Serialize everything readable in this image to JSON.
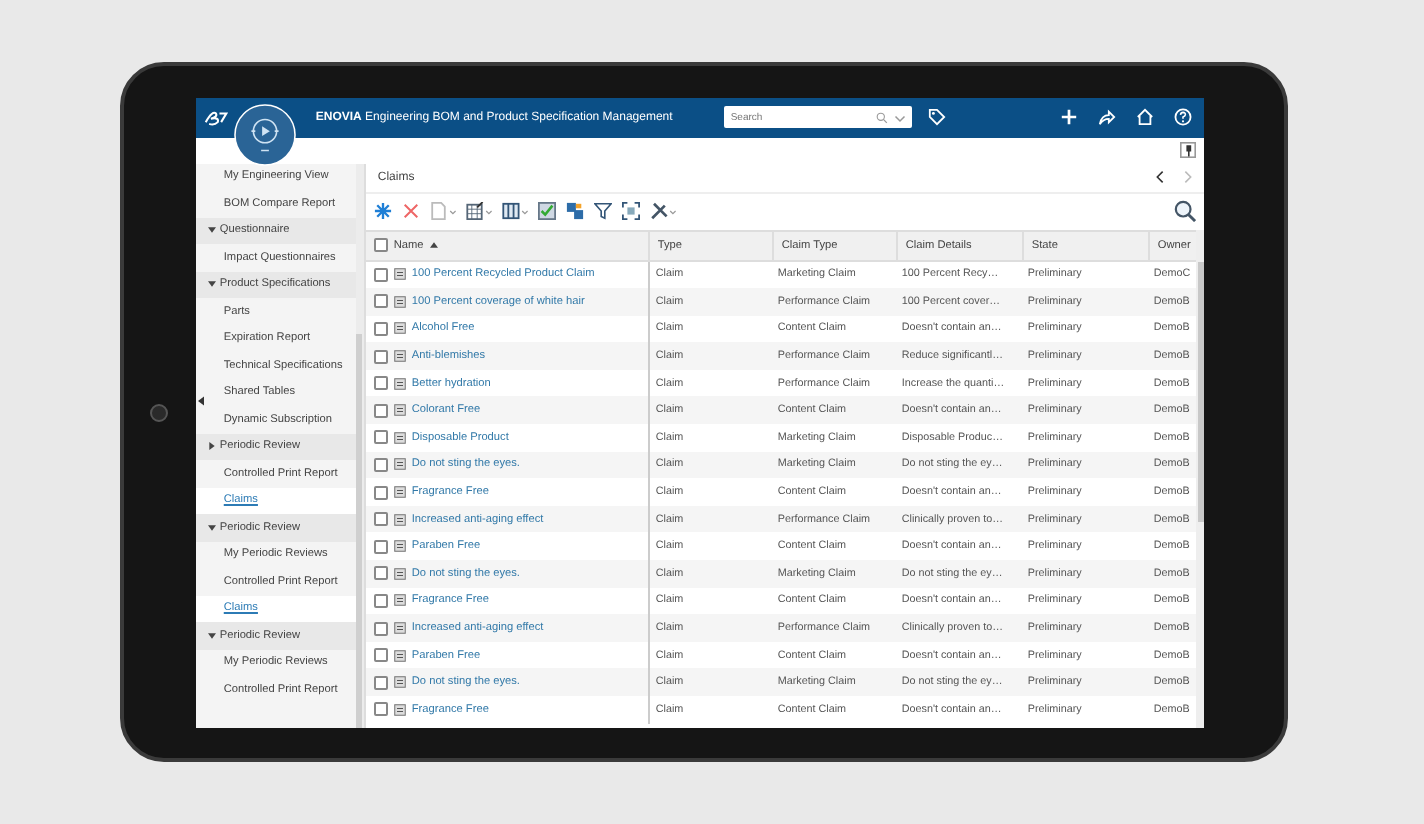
{
  "header": {
    "brand": "ENOVIA",
    "title": "Engineering BOM and Product Specification Management",
    "search": {
      "placeholder": "Search"
    }
  },
  "sidebar": {
    "items": [
      {
        "label": "My Engineering View",
        "kind": "item"
      },
      {
        "label": "BOM Compare Report",
        "kind": "item"
      },
      {
        "label": "Questionnaire",
        "kind": "section",
        "expanded": true
      },
      {
        "label": "Impact Questionnaires",
        "kind": "item"
      },
      {
        "label": "Product Specifications",
        "kind": "section",
        "expanded": true
      },
      {
        "label": "Parts",
        "kind": "item"
      },
      {
        "label": "Expiration Report",
        "kind": "item"
      },
      {
        "label": "Technical Specifications",
        "kind": "item"
      },
      {
        "label": "Shared Tables",
        "kind": "item"
      },
      {
        "label": "Dynamic Subscription",
        "kind": "item"
      },
      {
        "label": "Periodic Review",
        "kind": "section",
        "expanded": false
      },
      {
        "label": "Controlled Print Report",
        "kind": "item"
      },
      {
        "label": "Claims",
        "kind": "link"
      },
      {
        "label": "Periodic Review",
        "kind": "section",
        "expanded": true
      },
      {
        "label": "My Periodic Reviews",
        "kind": "item"
      },
      {
        "label": "Controlled Print Report",
        "kind": "item"
      },
      {
        "label": "Claims",
        "kind": "link"
      },
      {
        "label": "Periodic Review",
        "kind": "section",
        "expanded": true
      },
      {
        "label": "My Periodic Reviews",
        "kind": "item"
      },
      {
        "label": "Controlled Print Report",
        "kind": "item"
      }
    ]
  },
  "breadcrumb": "Claims",
  "table": {
    "select_all_checked": false,
    "columns": [
      {
        "label": "Name",
        "sorted": true
      },
      {
        "label": "Type"
      },
      {
        "label": "Claim Type"
      },
      {
        "label": "Claim Details"
      },
      {
        "label": "State"
      },
      {
        "label": "Owner"
      }
    ],
    "rows": [
      {
        "checked": false,
        "cells": [
          "100 Percent Recycled Product Claim",
          "Claim",
          "Marketing Claim",
          "100 Percent Recy…",
          "Preliminary",
          "DemoC"
        ]
      },
      {
        "checked": false,
        "cells": [
          "100 Percent coverage of white hair",
          "Claim",
          "Performance Claim",
          "100 Percent cover…",
          "Preliminary",
          "DemoB"
        ]
      },
      {
        "checked": false,
        "cells": [
          "Alcohol Free",
          "Claim",
          "Content Claim",
          "Doesn't contain an…",
          "Preliminary",
          "DemoB"
        ]
      },
      {
        "checked": false,
        "cells": [
          "Anti-blemishes",
          "Claim",
          "Performance Claim",
          "Reduce significantl…",
          "Preliminary",
          "DemoB"
        ]
      },
      {
        "checked": false,
        "cells": [
          "Better hydration",
          "Claim",
          "Performance Claim",
          "Increase the quanti…",
          "Preliminary",
          "DemoB"
        ]
      },
      {
        "checked": false,
        "cells": [
          "Colorant Free",
          "Claim",
          "Content Claim",
          "Doesn't contain an…",
          "Preliminary",
          "DemoB"
        ]
      },
      {
        "checked": false,
        "cells": [
          "Disposable Product",
          "Claim",
          "Marketing Claim",
          "Disposable Produc…",
          "Preliminary",
          "DemoB"
        ]
      },
      {
        "checked": false,
        "cells": [
          "Do not sting the eyes.",
          "Claim",
          "Marketing Claim",
          "Do not sting the ey…",
          "Preliminary",
          "DemoB"
        ]
      },
      {
        "checked": false,
        "cells": [
          "Fragrance Free",
          "Claim",
          "Content Claim",
          "Doesn't contain an…",
          "Preliminary",
          "DemoB"
        ]
      },
      {
        "checked": false,
        "cells": [
          "Increased anti-aging effect",
          "Claim",
          "Performance Claim",
          "Clinically proven to…",
          "Preliminary",
          "DemoB"
        ]
      },
      {
        "checked": false,
        "cells": [
          "Paraben Free",
          "Claim",
          "Content Claim",
          "Doesn't contain an…",
          "Preliminary",
          "DemoB"
        ]
      },
      {
        "checked": false,
        "cells": [
          "Do not sting the eyes.",
          "Claim",
          "Marketing Claim",
          "Do not sting the ey…",
          "Preliminary",
          "DemoB"
        ]
      },
      {
        "checked": false,
        "cells": [
          "Fragrance Free",
          "Claim",
          "Content Claim",
          "Doesn't contain an…",
          "Preliminary",
          "DemoB"
        ]
      },
      {
        "checked": false,
        "cells": [
          "Increased anti-aging effect",
          "Claim",
          "Performance Claim",
          "Clinically proven to…",
          "Preliminary",
          "DemoB"
        ]
      },
      {
        "checked": false,
        "cells": [
          "Paraben Free",
          "Claim",
          "Content Claim",
          "Doesn't contain an…",
          "Preliminary",
          "DemoB"
        ]
      },
      {
        "checked": false,
        "cells": [
          "Do not sting the eyes.",
          "Claim",
          "Marketing Claim",
          "Do not sting the ey…",
          "Preliminary",
          "DemoB"
        ]
      },
      {
        "checked": false,
        "cells": [
          "Fragrance Free",
          "Claim",
          "Content Claim",
          "Doesn't contain an…",
          "Preliminary",
          "DemoB"
        ]
      }
    ]
  }
}
